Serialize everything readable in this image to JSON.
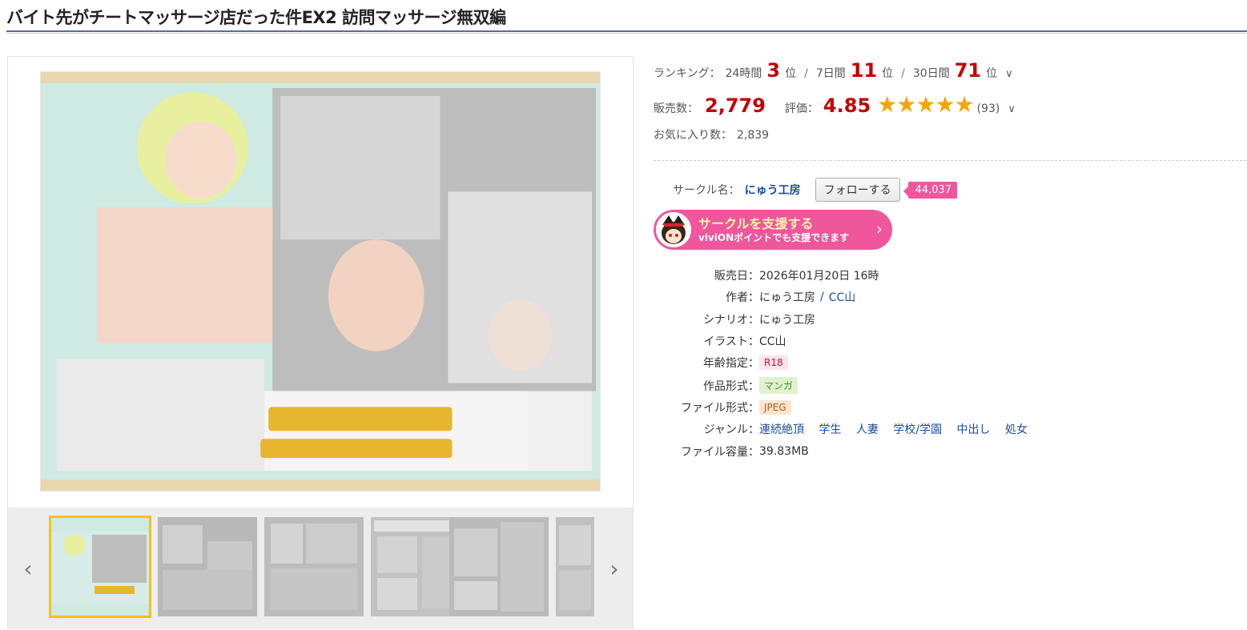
{
  "title": "バイト先がチートマッサージ店だった件EX2 訪問マッサージ無双編",
  "ranking": {
    "label": "ランキング：",
    "h24_label": "24時間",
    "h24_value": "3",
    "d7_label": "7日間",
    "d7_value": "11",
    "d30_label": "30日間",
    "d30_value": "71",
    "unit": "位",
    "separator": "/"
  },
  "sales": {
    "label": "販売数：",
    "value": "2,779",
    "rating_label": "評価：",
    "rating_value": "4.85",
    "stars": "★★★★★",
    "rating_count": "(93)"
  },
  "favorites": {
    "label": "お気に入り数：",
    "value": "2,839"
  },
  "circle": {
    "label": "サークル名：",
    "name": "にゅう工房",
    "follow_label": "フォローする",
    "follow_count": "44,037"
  },
  "support": {
    "title": "サークルを支援する",
    "subtitle": "viviONポイントでも支援できます",
    "arrow_icon": "chevron-right-icon"
  },
  "specs": {
    "release_label": "販売日",
    "release_value": "2026年01月20日 16時",
    "author_label": "作者",
    "author_1": "にゅう工房",
    "author_sep": "/",
    "author_2": "CC山",
    "scenario_label": "シナリオ",
    "scenario_value": "にゅう工房",
    "illust_label": "イラスト",
    "illust_value": "CC山",
    "age_label": "年齢指定",
    "age_value": "R18",
    "format_label": "作品形式",
    "format_value": "マンガ",
    "file_label": "ファイル形式",
    "file_value": "JPEG",
    "genre_label": "ジャンル",
    "genres": [
      "連続絶頂",
      "学生",
      "人妻",
      "学校/学園",
      "中出し",
      "処女"
    ],
    "size_label": "ファイル容量",
    "size_value": "39.83MB",
    "colon": "："
  },
  "colors": {
    "accent_red": "#c40000",
    "link_blue": "#1a4d9e",
    "pink": "#f0569b",
    "star": "#f6a500",
    "thumb_active": "#f5c400"
  },
  "thumbnails": [
    "thumb-1",
    "thumb-2",
    "thumb-3",
    "thumb-4",
    "thumb-5",
    "thumb-6"
  ]
}
